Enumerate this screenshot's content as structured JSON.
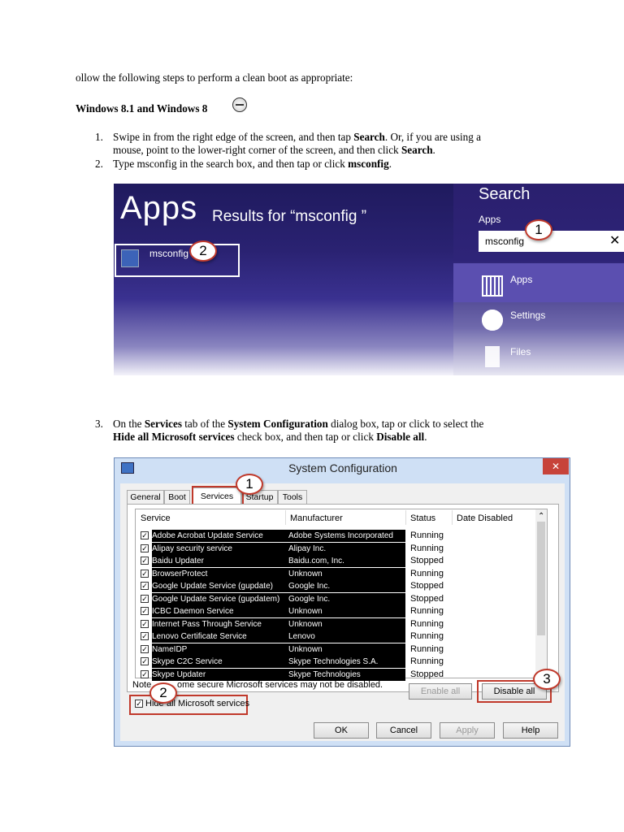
{
  "intro": "ollow the following steps to perform a clean boot as appropriate:",
  "heading": "Windows 8.1 and Windows 8",
  "steps": {
    "s1_num": "1.",
    "s1_a": "Swipe in from the right edge of the screen, and then tap ",
    "s1_b": "Search",
    "s1_c": ". Or, if you are using a",
    "s1_d": "mouse, point to the lower-right corner of the screen, and then click ",
    "s1_e": "Search",
    "s1_f": ".",
    "s2_num": "2.",
    "s2_a": "Type msconfig in the search box, and then tap or click ",
    "s2_b": "msconfig",
    "s2_c": ".",
    "s3_num": "3.",
    "s3_a": "On the ",
    "s3_b": "Services",
    "s3_c": " tab of the ",
    "s3_d": "System Configuration",
    "s3_e": " dialog box, tap or click to select the",
    "s3_f": "Hide all Microsoft services",
    "s3_g": " check box, and then tap or click ",
    "s3_h": "Disable all",
    "s3_i": "."
  },
  "search_shot": {
    "apps_title": "Apps",
    "results_text": "Results for “msconfig ”",
    "result_item": "msconfig",
    "charm_title": "Search",
    "charm_scope": "Apps",
    "search_value": "msconfig",
    "clear_glyph": "✕",
    "rows": [
      "Apps",
      "Settings",
      "Files"
    ]
  },
  "callouts": {
    "one": "1",
    "two": "2",
    "three": "3"
  },
  "dialog": {
    "title": "System Configuration",
    "close": "✕",
    "tabs": [
      "General",
      "Boot",
      "Services",
      "Startup",
      "Tools"
    ],
    "columns": [
      "Service",
      "Manufacturer",
      "Status",
      "Date Disabled"
    ],
    "services": [
      {
        "name": "Adobe Acrobat Update Service",
        "maker": "Adobe Systems Incorporated",
        "status": "Running"
      },
      {
        "name": "Alipay security service",
        "maker": "Alipay Inc.",
        "status": "Running"
      },
      {
        "name": "Baidu Updater",
        "maker": "Baidu.com, Inc.",
        "status": "Stopped"
      },
      {
        "name": "BrowserProtect",
        "maker": "Unknown",
        "status": "Running"
      },
      {
        "name": "Google Update Service (gupdate)",
        "maker": "Google Inc.",
        "status": "Stopped"
      },
      {
        "name": "Google Update Service (gupdatem)",
        "maker": "Google Inc.",
        "status": "Stopped"
      },
      {
        "name": "ICBC Daemon Service",
        "maker": "Unknown",
        "status": "Running"
      },
      {
        "name": "Internet Pass Through Service",
        "maker": "Unknown",
        "status": "Running"
      },
      {
        "name": "Lenovo Certificate Service",
        "maker": "Lenovo",
        "status": "Running"
      },
      {
        "name": "NameIDP",
        "maker": "Unknown",
        "status": "Running"
      },
      {
        "name": "Skype C2C Service",
        "maker": "Skype Technologies S.A.",
        "status": "Running"
      },
      {
        "name": "Skype Updater",
        "maker": "Skype Technologies",
        "status": "Stopped"
      }
    ],
    "note": "Note: Some secure Microsoft services may not be disabled.",
    "note_left": "Note",
    "note_right": "ome secure Microsoft services may not be disabled.",
    "enable_all": "Enable all",
    "disable_all": "Disable all",
    "hide_ms": "Hide all Microsoft services",
    "hide_ms_left": "Hide",
    "hide_ms_right": "all Microsoft services",
    "ok": "OK",
    "cancel": "Cancel",
    "apply": "Apply",
    "help": "Help"
  }
}
